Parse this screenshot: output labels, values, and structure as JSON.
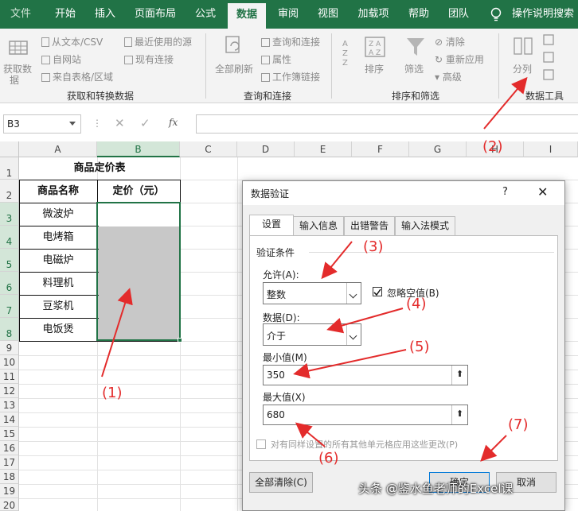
{
  "ribbon": {
    "tabs": [
      "文件",
      "开始",
      "插入",
      "页面布局",
      "公式",
      "数据",
      "审阅",
      "视图",
      "加载项",
      "帮助",
      "团队"
    ],
    "active_tab": "数据",
    "tell_me": "操作说明搜索",
    "groups": {
      "get_transform": {
        "label": "获取和转换数据",
        "get_data": "获取数",
        "get_data2": "据",
        "from_text": "从文本/CSV",
        "from_web": "自网站",
        "from_table": "来自表格/区域",
        "recent_sources": "最近使用的源",
        "existing_conn": "现有连接"
      },
      "queries": {
        "label": "查询和连接",
        "refresh_all": "全部刷新",
        "queries_conn": "查询和连接",
        "properties": "属性",
        "edit_links": "工作簿链接"
      },
      "sort_filter": {
        "label": "排序和筛选",
        "sort": "排序",
        "filter": "筛选",
        "clear": "清除",
        "reapply": "重新应用",
        "advanced": "高级"
      },
      "data_tools": {
        "label": "数据工具",
        "text_to_cols": "分列"
      }
    }
  },
  "formula_bar": {
    "name_box": "B3",
    "fx": "fx",
    "formula": ""
  },
  "sheet": {
    "columns": [
      "A",
      "B",
      "C",
      "D",
      "E",
      "F",
      "G",
      "H",
      "I"
    ],
    "rows": [
      "1",
      "2",
      "3",
      "4",
      "5",
      "6",
      "7",
      "8",
      "9",
      "10",
      "11",
      "12",
      "13",
      "14",
      "15",
      "16",
      "17",
      "18",
      "19",
      "20"
    ],
    "table_title": "商品定价表",
    "header_name": "商品名称",
    "header_price": "定价（元）",
    "products": [
      "微波炉",
      "电烤箱",
      "电磁炉",
      "料理机",
      "豆浆机",
      "电饭煲"
    ]
  },
  "dialog": {
    "title": "数据验证",
    "help": "?",
    "close": "✕",
    "tabs": [
      "设置",
      "输入信息",
      "出错警告",
      "输入法模式"
    ],
    "section": "验证条件",
    "allow_label": "允许(A):",
    "allow_value": "整数",
    "ignore_blank": "忽略空值(B)",
    "data_label": "数据(D):",
    "data_value": "介于",
    "min_label": "最小值(M)",
    "min_value": "350",
    "max_label": "最大值(X)",
    "max_value": "680",
    "apply_all": "对有同样设置的所有其他单元格应用这些更改(P)",
    "clear_all": "全部清除(C)",
    "ok": "确定",
    "cancel": "取消"
  },
  "annotations": {
    "a1": "(1)",
    "a2": "(2)",
    "a3": "(3)",
    "a4": "(4)",
    "a5": "(5)",
    "a6": "(6)",
    "a7": "(7)"
  },
  "watermark": "头条 @鉴水鱼老师的Excel课",
  "colors": {
    "excel_green": "#217346",
    "annotation_red": "#e32b2b",
    "selection_gray": "#c8c8c8"
  }
}
